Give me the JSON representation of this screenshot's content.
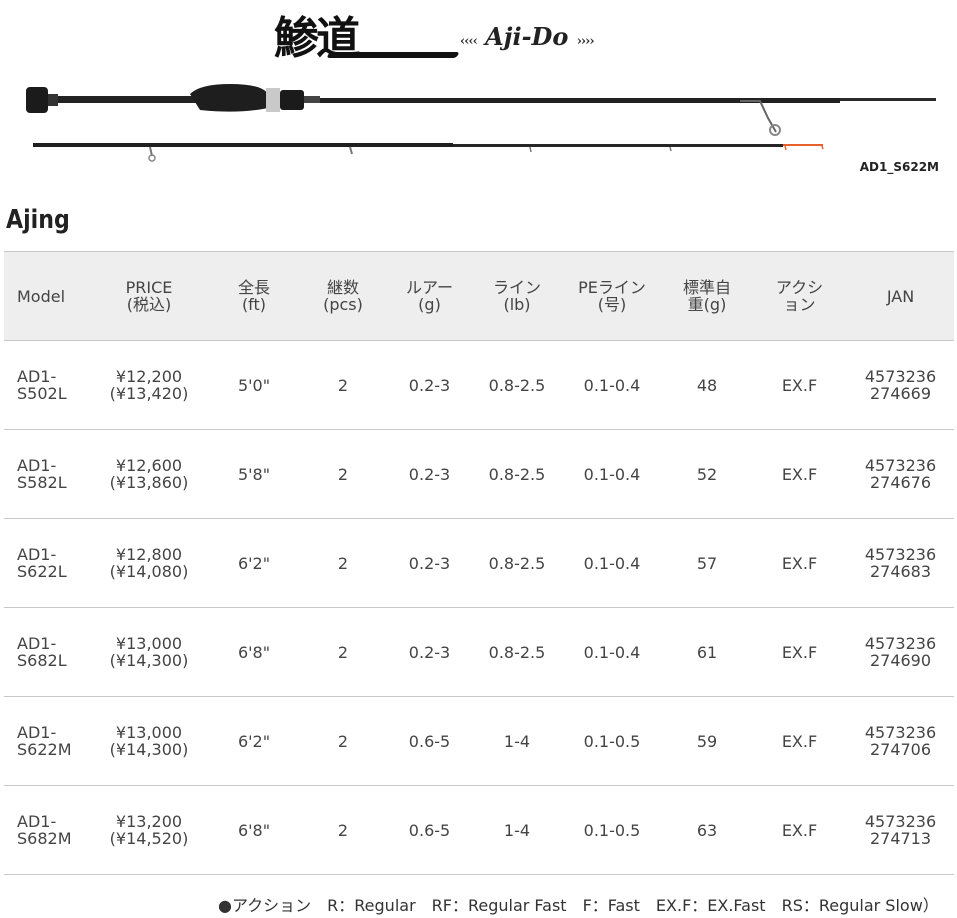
{
  "brand": {
    "kanji": "鯵道",
    "roman": "Aji-Do",
    "marks_left": "‹‹‹‹",
    "marks_right": "››››"
  },
  "rod_image": {
    "model_label": "AD1_S622M"
  },
  "section_title": "Ajing",
  "table": {
    "headers": [
      [
        "Model"
      ],
      [
        "PRICE",
        "(税込)"
      ],
      [
        "全長",
        "(ft)"
      ],
      [
        "継数",
        "(pcs)"
      ],
      [
        "ルアー",
        "(g)"
      ],
      [
        "ライン",
        "(lb)"
      ],
      [
        "PEライン",
        "(号)"
      ],
      [
        "標準自",
        "重(g)"
      ],
      [
        "アクシ",
        "ョン"
      ],
      [
        "JAN"
      ]
    ],
    "rows": [
      {
        "model": [
          "AD1-",
          "S502L"
        ],
        "price": [
          "¥12,200",
          "(¥13,420)"
        ],
        "length": "5'0\"",
        "pcs": "2",
        "lure": "0.2-3",
        "line": "0.8-2.5",
        "pe": "0.1-0.4",
        "weight": "48",
        "action": "EX.F",
        "jan": [
          "4573236",
          "274669"
        ]
      },
      {
        "model": [
          "AD1-",
          "S582L"
        ],
        "price": [
          "¥12,600",
          "(¥13,860)"
        ],
        "length": "5'8\"",
        "pcs": "2",
        "lure": "0.2-3",
        "line": "0.8-2.5",
        "pe": "0.1-0.4",
        "weight": "52",
        "action": "EX.F",
        "jan": [
          "4573236",
          "274676"
        ]
      },
      {
        "model": [
          "AD1-",
          "S622L"
        ],
        "price": [
          "¥12,800",
          "(¥14,080)"
        ],
        "length": "6'2\"",
        "pcs": "2",
        "lure": "0.2-3",
        "line": "0.8-2.5",
        "pe": "0.1-0.4",
        "weight": "57",
        "action": "EX.F",
        "jan": [
          "4573236",
          "274683"
        ]
      },
      {
        "model": [
          "AD1-",
          "S682L"
        ],
        "price": [
          "¥13,000",
          "(¥14,300)"
        ],
        "length": "6'8\"",
        "pcs": "2",
        "lure": "0.2-3",
        "line": "0.8-2.5",
        "pe": "0.1-0.4",
        "weight": "61",
        "action": "EX.F",
        "jan": [
          "4573236",
          "274690"
        ]
      },
      {
        "model": [
          "AD1-",
          "S622M"
        ],
        "price": [
          "¥13,000",
          "(¥14,300)"
        ],
        "length": "6'2\"",
        "pcs": "2",
        "lure": "0.6-5",
        "line": "1-4",
        "pe": "0.1-0.5",
        "weight": "59",
        "action": "EX.F",
        "jan": [
          "4573236",
          "274706"
        ]
      },
      {
        "model": [
          "AD1-",
          "S682M"
        ],
        "price": [
          "¥13,200",
          "(¥14,520)"
        ],
        "length": "6'8\"",
        "pcs": "2",
        "lure": "0.6-5",
        "line": "1-4",
        "pe": "0.1-0.5",
        "weight": "63",
        "action": "EX.F",
        "jan": [
          "4573236",
          "274713"
        ]
      }
    ]
  },
  "legend": "●アクション　R：Regular　RF：Regular Fast　F：Fast　EX.F：EX.Fast　RS：Regular Slow）",
  "colors": {
    "header_bg": "#eeeeee",
    "rule": "#c8c8c8",
    "tip_accent": "#e8602c"
  }
}
